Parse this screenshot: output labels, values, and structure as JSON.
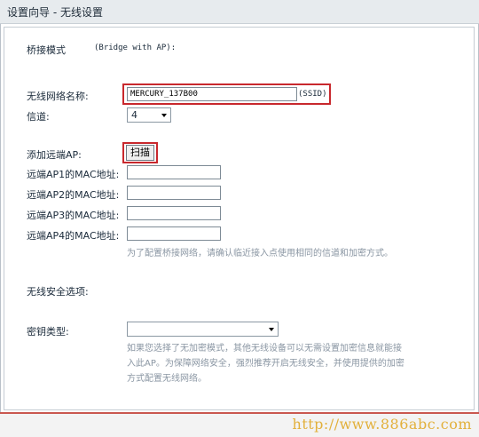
{
  "title": "设置向导 - 无线设置",
  "bridge": {
    "label": "桥接模式",
    "note": "(Bridge with AP):"
  },
  "ssid": {
    "label": "无线网络名称:",
    "value": "MERCURY_137B00",
    "suffix": "(SSID)"
  },
  "channel": {
    "label": "信道:",
    "value": "4"
  },
  "remote_ap": {
    "label": "添加远端AP:",
    "scan_button": "扫描",
    "mac_fields": [
      {
        "label": "远端AP1的MAC地址:",
        "value": ""
      },
      {
        "label": "远端AP2的MAC地址:",
        "value": ""
      },
      {
        "label": "远端AP3的MAC地址:",
        "value": ""
      },
      {
        "label": "远端AP4的MAC地址:",
        "value": ""
      }
    ],
    "hint": "为了配置桥接网络，请确认临近接入点使用相同的信道和加密方式。"
  },
  "security": {
    "section_label": "无线安全选项:",
    "key_type_label": "密钥类型:",
    "key_type_value": "",
    "hint_lines": [
      "如果您选择了无加密模式，其他无线设备可以无需设置加密信息就能接",
      "入此AP。为保障网络安全，强烈推荐开启无线安全，并使用提供的加密",
      "方式配置无线网络。"
    ]
  },
  "watermark": "http://www.886abc.com",
  "colors": {
    "highlight": "#c8282d",
    "bottom_rule": "#c9574f",
    "watermark": "#e2b03b"
  }
}
